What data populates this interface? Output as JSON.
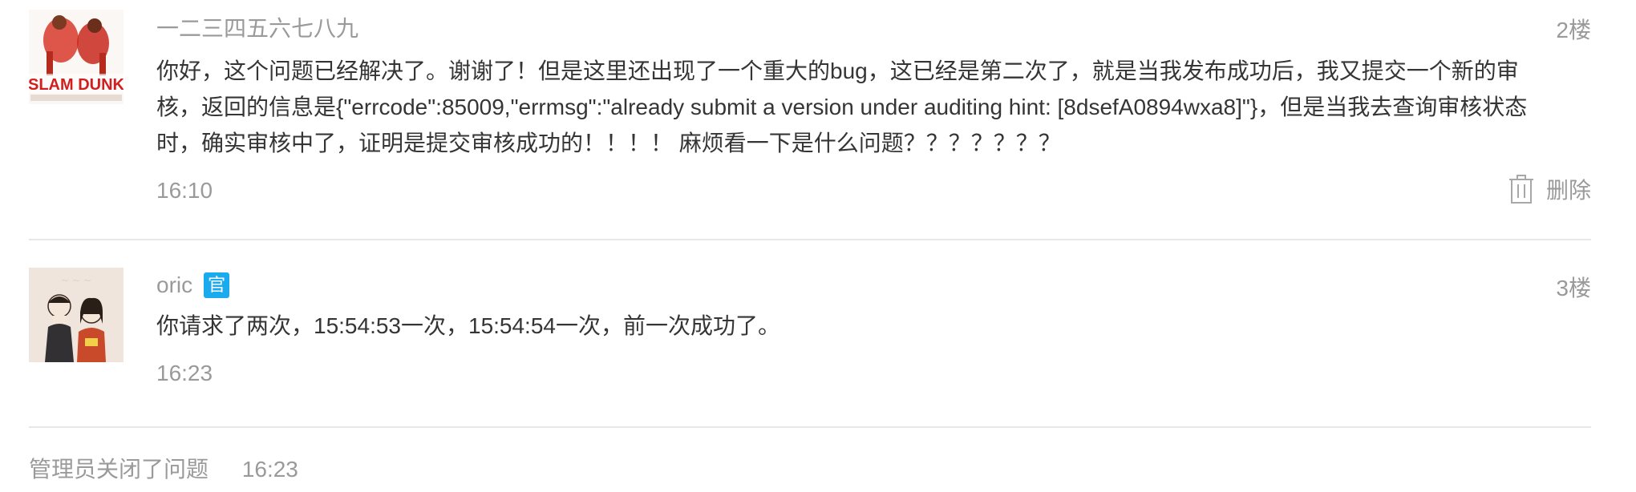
{
  "replies": [
    {
      "author": "一二三四五六七八九",
      "floor": "2楼",
      "content": "你好，这个问题已经解决了。谢谢了！但是这里还出现了一个重大的bug，这已经是第二次了，就是当我发布成功后，我又提交一个新的审核，返回的信息是{\"errcode\":85009,\"errmsg\":\"already submit a version under auditing hint: [8dsefA0894wxa8]\"}，但是当我去查询审核状态时，确实审核中了，证明是提交审核成功的！！！！ 麻烦看一下是什么问题？？？？？？？",
      "time": "16:10",
      "delete_label": "删除",
      "avatar_text": "SLAM DUNK"
    },
    {
      "author": "oric",
      "badge": "官",
      "floor": "3楼",
      "content": "你请求了两次，15:54:53一次，15:54:54一次，前一次成功了。",
      "time": "16:23"
    }
  ],
  "close_note": {
    "text": "管理员关闭了问题",
    "time": "16:23"
  },
  "colors": {
    "text": "#353535",
    "muted": "#9a9a9a",
    "divider": "#e7e7eb",
    "badge": "#1aabef"
  }
}
